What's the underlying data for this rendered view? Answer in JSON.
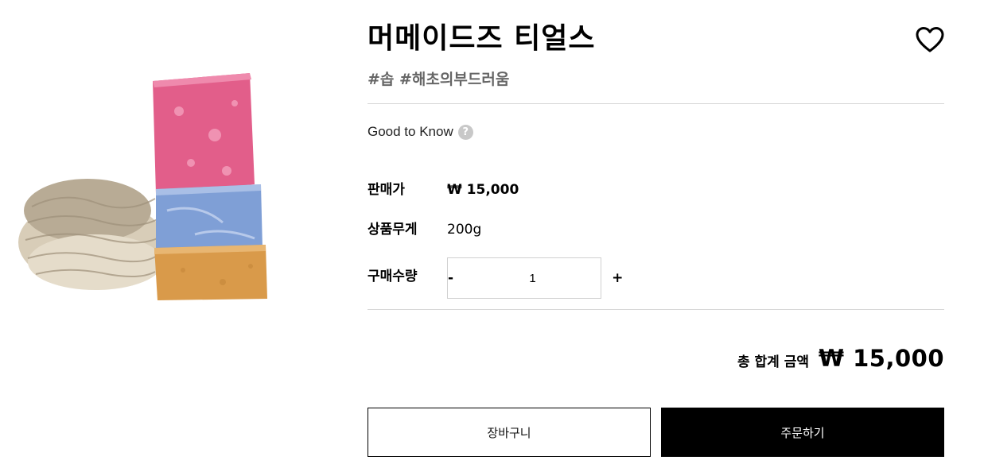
{
  "product": {
    "title": "머메이드즈 티얼스",
    "tags": "#솝 #해초의부드러움",
    "image": "handmade soap bars stacked (pink, blue, yellow) beside a woven loofah"
  },
  "good_to_know": {
    "label": "Good to Know",
    "help_icon": "?"
  },
  "price": {
    "label": "판매가",
    "value": "₩ 15,000"
  },
  "weight": {
    "label": "상품무게",
    "value": "200g"
  },
  "quantity": {
    "label": "구매수량",
    "minus": "-",
    "value": "1",
    "plus": "+"
  },
  "total": {
    "label": "총 합계 금액",
    "amount": "₩ 15,000"
  },
  "actions": {
    "cart_label": "장바구니",
    "order_label": "주문하기"
  },
  "icons": {
    "wishlist": "heart-outline-icon",
    "help": "question-circle-icon"
  },
  "colors": {
    "primary": "#000000",
    "tag_text": "#666666",
    "divider": "#d6d6d6",
    "help_icon_bg": "#c8c8c8"
  }
}
